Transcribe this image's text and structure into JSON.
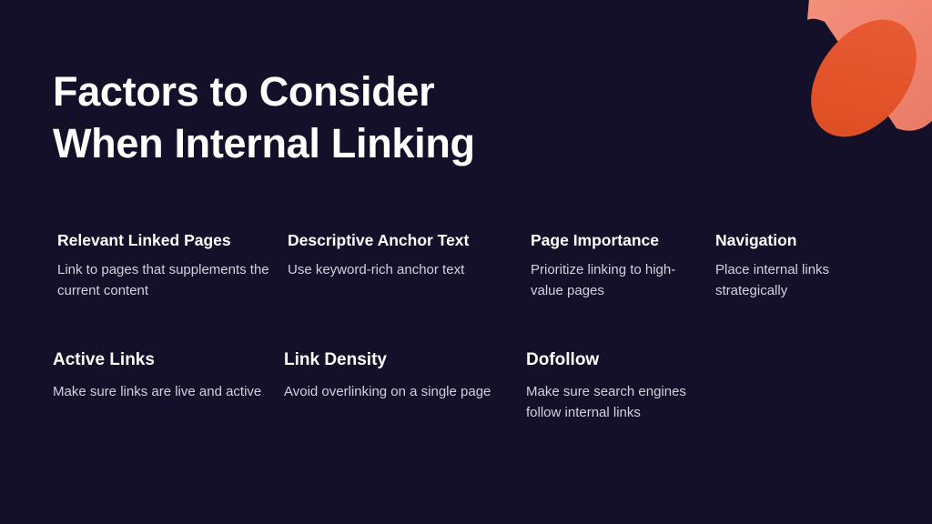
{
  "slide": {
    "background_color": "#141029",
    "heading_color": "#ffffff",
    "body_color": "#d3d0dd",
    "accent_color": "#e2562c",
    "accent_light_color": "#ef8471"
  },
  "title": {
    "line1": "Factors to Consider",
    "line2": "When Internal Linking"
  },
  "decoration": {
    "name": "cone-shape",
    "label": "3D cone graphic"
  },
  "rows": [
    {
      "name": "row-1",
      "items": [
        {
          "heading": "Relevant Linked Pages",
          "body": "Link to pages that supplements the current content"
        },
        {
          "heading": "Descriptive Anchor Text",
          "body": "Use keyword-rich anchor text"
        },
        {
          "heading": "Page Importance",
          "body": "Prioritize linking to high-value pages"
        },
        {
          "heading": "Navigation",
          "body": "Place internal links strategically"
        }
      ]
    },
    {
      "name": "row-2",
      "items": [
        {
          "heading": "Active Links",
          "body": "Make sure links are live and active"
        },
        {
          "heading": "Link Density",
          "body": "Avoid overlinking on a single page"
        },
        {
          "heading": "Dofollow",
          "body": "Make sure search engines follow internal links"
        }
      ]
    }
  ]
}
